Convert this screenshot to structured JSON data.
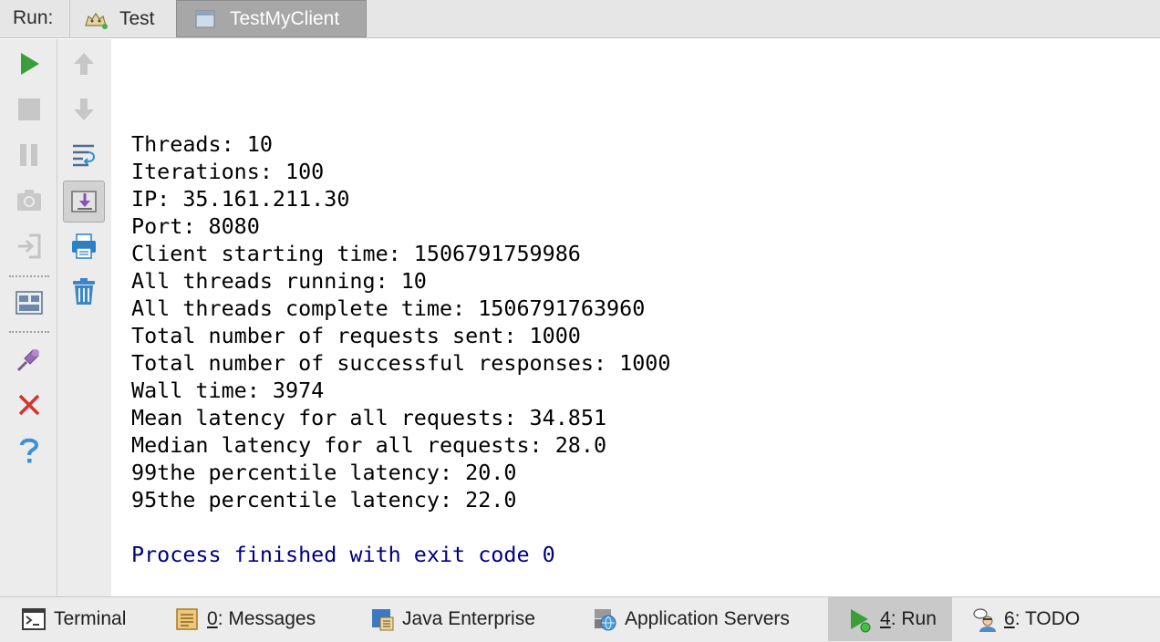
{
  "tabbar": {
    "run_label": "Run:",
    "tabs": [
      {
        "label": "Test",
        "icon": "tomcat-icon",
        "active": false
      },
      {
        "label": "TestMyClient",
        "icon": "application-icon",
        "active": true
      }
    ]
  },
  "toolbar_left": [
    "run-icon",
    "stop-icon",
    "pause-icon",
    "camera-icon",
    "exit-icon",
    "layout-icon",
    "pin-icon",
    "close-icon",
    "help-icon"
  ],
  "toolbar_right": [
    "up-arrow-icon",
    "down-arrow-icon",
    "soft-wrap-icon",
    "scroll-to-end-icon",
    "print-icon",
    "trash-icon"
  ],
  "console": {
    "lines": [
      "Threads: 10",
      "Iterations: 100",
      "IP: 35.161.211.30",
      "Port: 8080",
      "Client starting time: 1506791759986",
      "All threads running: 10",
      "All threads complete time: 1506791763960",
      "Total number of requests sent: 1000",
      "Total number of successful responses: 1000",
      "Wall time: 3974",
      "Mean latency for all requests: 34.851",
      "Median latency for all requests: 28.0",
      "99the percentile latency: 20.0",
      "95the percentile latency: 22.0"
    ],
    "exit_message": "Process finished with exit code 0"
  },
  "bottombar": {
    "terminal": {
      "label": "Terminal"
    },
    "messages": {
      "key": "0",
      "rest": ": Messages"
    },
    "java_enterprise": {
      "label": "Java Enterprise"
    },
    "app_servers": {
      "label": "Application Servers"
    },
    "run": {
      "key": "4",
      "rest": ": Run"
    },
    "todo": {
      "key": "6",
      "rest": ": TODO"
    }
  },
  "colors": {
    "run_green": "#3a9e3a",
    "stop_red": "#d9302c",
    "help_blue": "#3d8fd6",
    "exit_text": "#000080"
  }
}
